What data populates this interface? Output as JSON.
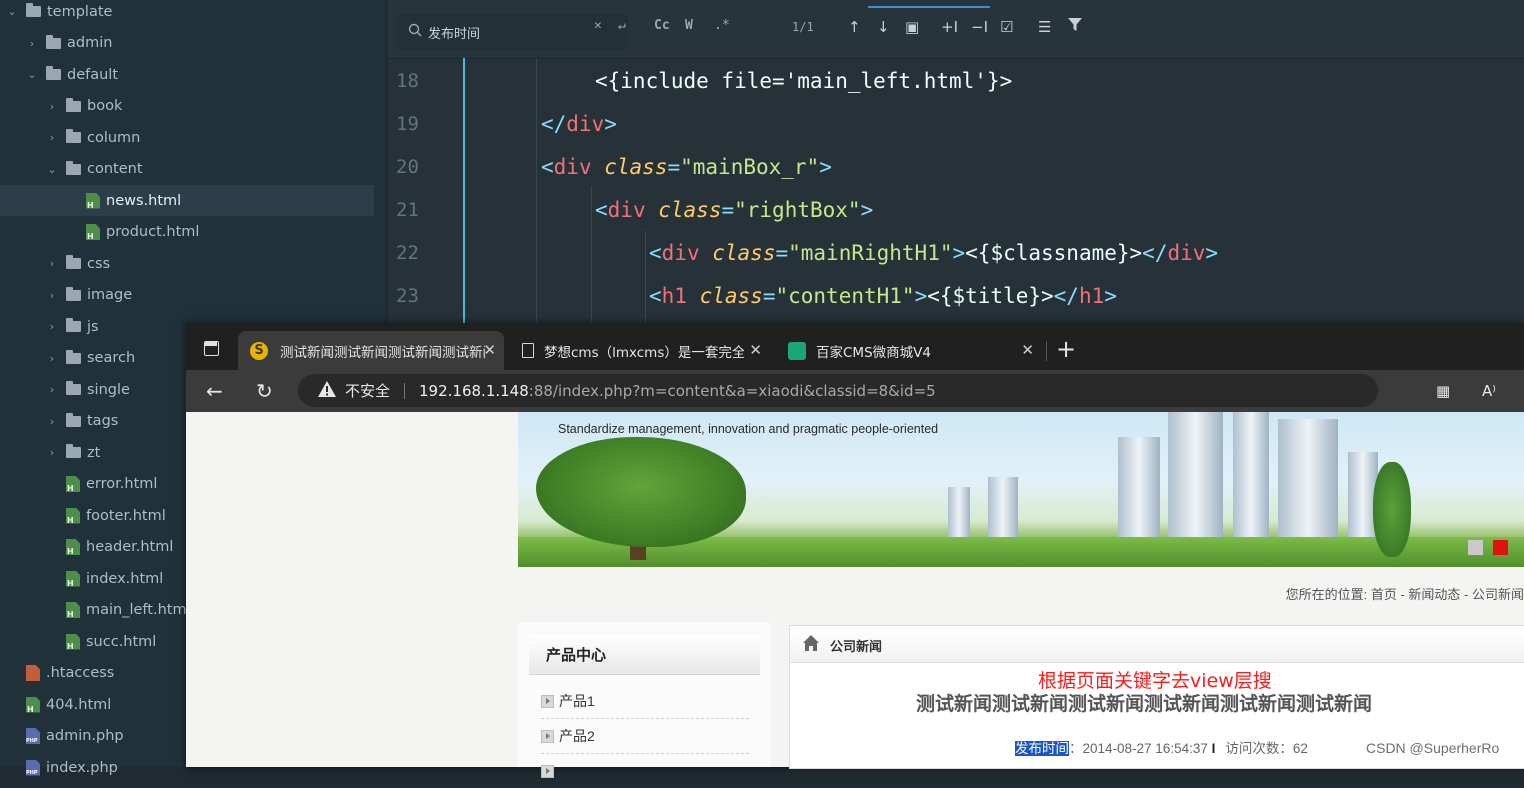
{
  "sidebar": {
    "items": [
      {
        "label": "template",
        "type": "folder",
        "expanded": true
      },
      {
        "label": "admin",
        "type": "folder",
        "expanded": false
      },
      {
        "label": "default",
        "type": "folder",
        "expanded": true
      },
      {
        "label": "book",
        "type": "folder",
        "expanded": false
      },
      {
        "label": "column",
        "type": "folder",
        "expanded": false
      },
      {
        "label": "content",
        "type": "folder",
        "expanded": true
      },
      {
        "label": "news.html",
        "type": "html",
        "selected": true
      },
      {
        "label": "product.html",
        "type": "html"
      },
      {
        "label": "css",
        "type": "folder",
        "expanded": false
      },
      {
        "label": "image",
        "type": "folder",
        "expanded": false
      },
      {
        "label": "js",
        "type": "folder",
        "expanded": false
      },
      {
        "label": "search",
        "type": "folder",
        "expanded": false
      },
      {
        "label": "single",
        "type": "folder",
        "expanded": false
      },
      {
        "label": "tags",
        "type": "folder",
        "expanded": false
      },
      {
        "label": "zt",
        "type": "folder",
        "expanded": false
      },
      {
        "label": "error.html",
        "type": "html"
      },
      {
        "label": "footer.html",
        "type": "html"
      },
      {
        "label": "header.html",
        "type": "html"
      },
      {
        "label": "index.html",
        "type": "html"
      },
      {
        "label": "main_left.html",
        "type": "html"
      },
      {
        "label": "succ.html",
        "type": "html"
      },
      {
        "label": ".htaccess",
        "type": "ht"
      },
      {
        "label": "404.html",
        "type": "html"
      },
      {
        "label": "admin.php",
        "type": "php"
      },
      {
        "label": "index.php",
        "type": "php"
      }
    ]
  },
  "editor": {
    "find": {
      "query": "发布时间",
      "match_case_label": "Cc",
      "whole_word_label": "W",
      "regex_label": ".*",
      "result_count": "1/1"
    },
    "lines": [
      {
        "num": "18",
        "tokens": [
          [
            "t-txt",
            "<{include file='main_left.html'}>"
          ]
        ]
      },
      {
        "num": "19",
        "tokens": [
          [
            "t-br",
            "</"
          ],
          [
            "t-tag",
            "div"
          ],
          [
            "t-br",
            ">"
          ]
        ]
      },
      {
        "num": "20",
        "tokens": [
          [
            "t-br",
            "<"
          ],
          [
            "t-tag",
            "div"
          ],
          [
            "t-txt",
            " "
          ],
          [
            "t-attr",
            "class"
          ],
          [
            "t-br",
            "="
          ],
          [
            "t-str",
            "\"mainBox_r\""
          ],
          [
            "t-br",
            ">"
          ]
        ]
      },
      {
        "num": "21",
        "tokens": [
          [
            "t-br",
            "<"
          ],
          [
            "t-tag",
            "div"
          ],
          [
            "t-txt",
            " "
          ],
          [
            "t-attr",
            "class"
          ],
          [
            "t-br",
            "="
          ],
          [
            "t-str",
            "\"rightBox\""
          ],
          [
            "t-br",
            ">"
          ]
        ]
      },
      {
        "num": "22",
        "tokens": [
          [
            "t-br",
            "<"
          ],
          [
            "t-tag",
            "div"
          ],
          [
            "t-txt",
            " "
          ],
          [
            "t-attr",
            "class"
          ],
          [
            "t-br",
            "="
          ],
          [
            "t-str",
            "\"mainRightH1\""
          ],
          [
            "t-br",
            ">"
          ],
          [
            "t-txt",
            "<{$classname}>"
          ],
          [
            "t-br",
            "</"
          ],
          [
            "t-tag",
            "div"
          ],
          [
            "t-br",
            ">"
          ]
        ]
      },
      {
        "num": "23",
        "tokens": [
          [
            "t-br",
            "<"
          ],
          [
            "t-tag",
            "h1"
          ],
          [
            "t-txt",
            " "
          ],
          [
            "t-attr",
            "class"
          ],
          [
            "t-br",
            "="
          ],
          [
            "t-str",
            "\"contentH1\""
          ],
          [
            "t-br",
            ">"
          ],
          [
            "t-txt",
            "<{$title}>"
          ],
          [
            "t-br",
            "</"
          ],
          [
            "t-tag",
            "h1"
          ],
          [
            "t-br",
            ">"
          ]
        ]
      }
    ]
  },
  "browser": {
    "tabs": [
      {
        "title": "测试新闻测试新闻测试新闻测试新闻",
        "active": true
      },
      {
        "title": "梦想cms（lmxcms）是一套完全免费",
        "active": false
      },
      {
        "title": "百家CMS微商城V4",
        "active": false
      }
    ],
    "new_tab_label": "+",
    "security_label": "不安全",
    "url_host": "192.168.1.148",
    "url_rest": ":88/index.php?m=content&a=xiaodi&classid=8&id=5"
  },
  "page": {
    "slogan": "Standardize management, innovation and pragmatic people-oriented",
    "breadcrumb": "您所在的位置:  首页  -  新闻动态  -  公司新闻",
    "left_box_title": "产品中心",
    "products": [
      "产品1",
      "产品2"
    ],
    "section_title": "公司新闻",
    "annotation": "根据页面关键字去view层搜",
    "article_title": "测试新闻测试新闻测试新闻测试新闻测试新闻测试新闻",
    "meta_label": "发布时间",
    "meta_date": "：2014-08-27 16:54:37",
    "meta_views": "访问次数：62"
  },
  "watermark": "CSDN @SuperherRo",
  "colors": {
    "accent": "#3f8ccf",
    "highlight": "#1c55c4",
    "annotation": "#ff1a1a"
  }
}
